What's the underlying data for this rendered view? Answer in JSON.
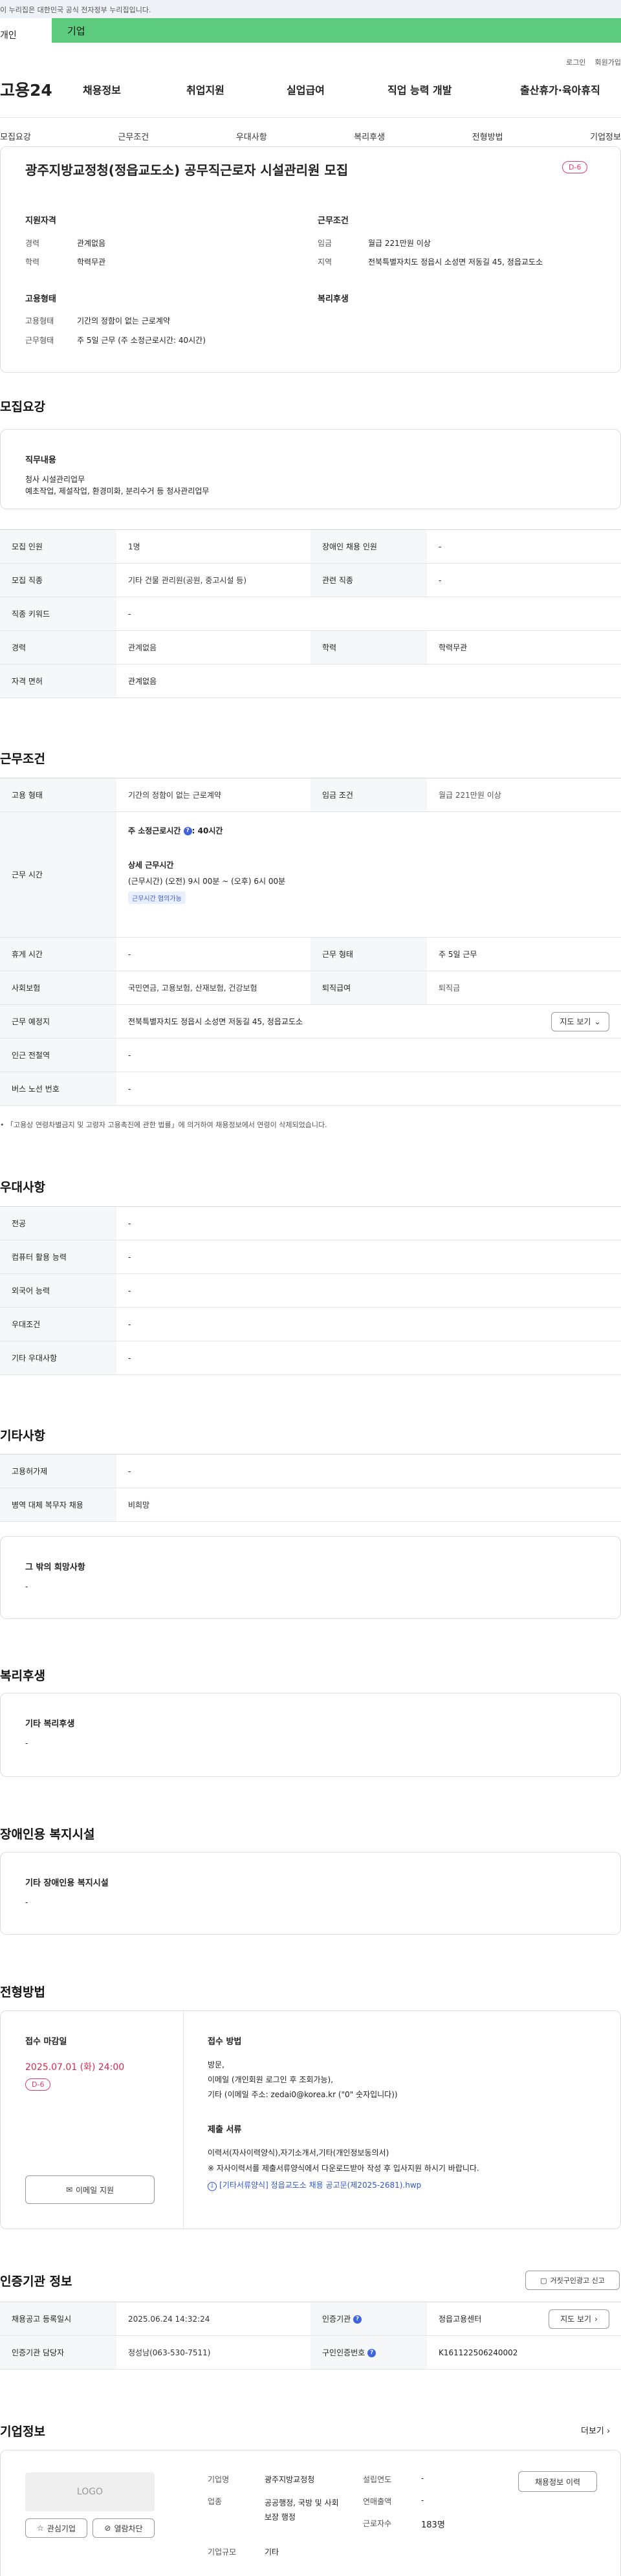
{
  "gov_notice": "이 누리집은 대한민국 공식 전자정부 누리집입니다.",
  "user_type": {
    "individual": "개인",
    "corporate": "기업"
  },
  "top_links": {
    "login": "로그인",
    "signup": "회원가입"
  },
  "logo": "고용24",
  "gnb": [
    "채용정보",
    "취업지원",
    "실업급여",
    "직업 능력 개발",
    "출산휴가·육아휴직"
  ],
  "subnav": [
    "모집요강",
    "근무조건",
    "우대사항",
    "복리후생",
    "전형방법",
    "기업정보"
  ],
  "job": {
    "title": "광주지방교정청(정읍교도소) 공무직근로자 시설관리원 모집",
    "dday": "D-6",
    "summary": {
      "qual_title": "지원자격",
      "career_label": "경력",
      "career": "관계없음",
      "edu_label": "학력",
      "edu": "학력무관",
      "cond_title": "근무조건",
      "wage_label": "임금",
      "wage": "월급 221만원 이상",
      "region_label": "지역",
      "region": "전북특별자치도 정읍시 소성면 저동길 45, 정읍교도소",
      "emp_title": "고용형태",
      "emptype_label": "고용형태",
      "emptype": "기간의 정함이 없는 근로계약",
      "worktype_label": "근무형태",
      "worktype": "주 5일 근무 (주 소정근로시간: 40시간)",
      "welfare_title": "복리후생"
    }
  },
  "recruit": {
    "title": "모집요강",
    "duty_title": "직무내용",
    "duty_lines": [
      "청사 시설관리업무",
      "예초작업, 제설작업, 환경미화, 분리수거 등 청사관리업무"
    ],
    "rows": [
      {
        "k1": "모집 인원",
        "v1": "1명",
        "k2": "장애인 채용 인원",
        "v2": "-"
      },
      {
        "k1": "모집 직종",
        "v1": "기타 건물 관리원(공원, 중고시설 등)",
        "k2": "관련 직종",
        "v2": "-"
      },
      {
        "k1": "직종 키워드",
        "v1": "-"
      },
      {
        "k1": "경력",
        "v1": "관계없음",
        "k2": "학력",
        "v2": "학력무관"
      },
      {
        "k1": "자격 면허",
        "v1": "관계없음"
      }
    ]
  },
  "work": {
    "title": "근무조건",
    "emptype_k": "고용 형태",
    "emptype_v": "기간의 정함이 없는 근로계약",
    "wage_k": "임금 조건",
    "wage_v": "월급 221만원 이상",
    "hours_k": "근무 시간",
    "hours_weekly": "주 소정근로시간",
    "hours_weekly_v": ": 40시간",
    "hours_detail_title": "상세 근무시간",
    "hours_detail": "(근무시간) (오전) 9시 00분 ~ (오후) 6시 00분",
    "hours_tag": "근무시간 협의가능",
    "break_k": "휴게 시간",
    "break_v": "-",
    "worktype_k": "근무 형태",
    "worktype_v": "주 5일 근무",
    "insurance_k": "사회보험",
    "insurance_v": "국민연금, 고용보험, 산재보험, 건강보험",
    "retire_k": "퇴직급여",
    "retire_v": "퇴직금",
    "place_k": "근무 예정지",
    "place_v": "전북특별자치도 정읍시 소성면 저동길 45, 정읍교도소",
    "map_btn": "지도 보기",
    "station_k": "인근 전철역",
    "station_v": "-",
    "bus_k": "버스 노선 번호",
    "bus_v": "-",
    "note": "「고용상 연령차별금지 및 고령자 고용촉진에 관한 법률」에 의거하여 채용정보에서 연령이 삭제되었습니다."
  },
  "prefer": {
    "title": "우대사항",
    "rows": [
      {
        "k": "전공",
        "v": "-"
      },
      {
        "k": "컴퓨터 활용 능력",
        "v": "-"
      },
      {
        "k": "외국어 능력",
        "v": "-"
      },
      {
        "k": "우대조건",
        "v": "-"
      },
      {
        "k": "기타 우대사항",
        "v": "-"
      }
    ]
  },
  "etc": {
    "title": "기타사항",
    "rows": [
      {
        "k": "고용허가제",
        "v": "-"
      },
      {
        "k": "병역 대체 복무자 채용",
        "v": "비희망"
      }
    ],
    "other_title": "그 밖의 희망사항",
    "other_v": "-"
  },
  "welfare": {
    "title": "복리후생",
    "box_title": "기타 복리후생",
    "box_v": "-"
  },
  "disability": {
    "title": "장애인용 복지시설",
    "box_title": "기타 장애인용 복지시설",
    "box_v": "-"
  },
  "screening": {
    "title": "전형방법",
    "deadline_title": "접수 마감일",
    "deadline": "2025.07.01 (화) 24:00",
    "dday": "D-6",
    "email_btn": "이메일 지원",
    "method_title": "접수 방법",
    "method_lines": [
      "방문,",
      "이메일 (개인회원 로그인 후 조회가능),",
      "기타 (이메일 주소: zedai0@korea.kr (\"0\" 숫자입니다))"
    ],
    "docs_title": "제출 서류",
    "docs_lines": [
      "이력서(자사이력양식),자기소개서,기타(개인정보동의서)",
      "※ 자사이력서를 제출서류양식에서 다운로드받아 작성 후 입사지원 하시기 바랍니다."
    ],
    "attachment": "[기타서류양식] 정읍교도소 채용 공고문(제2025-2681).hwp"
  },
  "cert": {
    "title": "인증기관 정보",
    "report_btn": "거짓구인광고 신고",
    "reg_k": "채용공고 등록일시",
    "reg_v": "2025.06.24 14:32:24",
    "org_k": "인증기관",
    "org_v": "정읍고용센터",
    "map_btn": "지도 보기",
    "manager_k": "인증기관 담당자",
    "manager_v": "정성남(063-530-7511)",
    "jobno_k": "구인인증번호",
    "jobno_v": "K161122506240002"
  },
  "company": {
    "title": "기업정보",
    "more": "더보기",
    "logo_text": "LOGO",
    "fav_btn": "관심기업",
    "block_btn": "열람차단",
    "name_k": "기업명",
    "name_v": "광주지방교정청",
    "industry_k": "업종",
    "industry_v": "공공행정, 국방 및 사회보장 행정",
    "size_k": "기업규모",
    "size_v": "기타",
    "founded_k": "설립연도",
    "founded_v": "-",
    "sales_k": "연매출액",
    "sales_v": "-",
    "emp_k": "근로자수",
    "emp_v": "183명",
    "history_btn": "채용정보 이력"
  }
}
